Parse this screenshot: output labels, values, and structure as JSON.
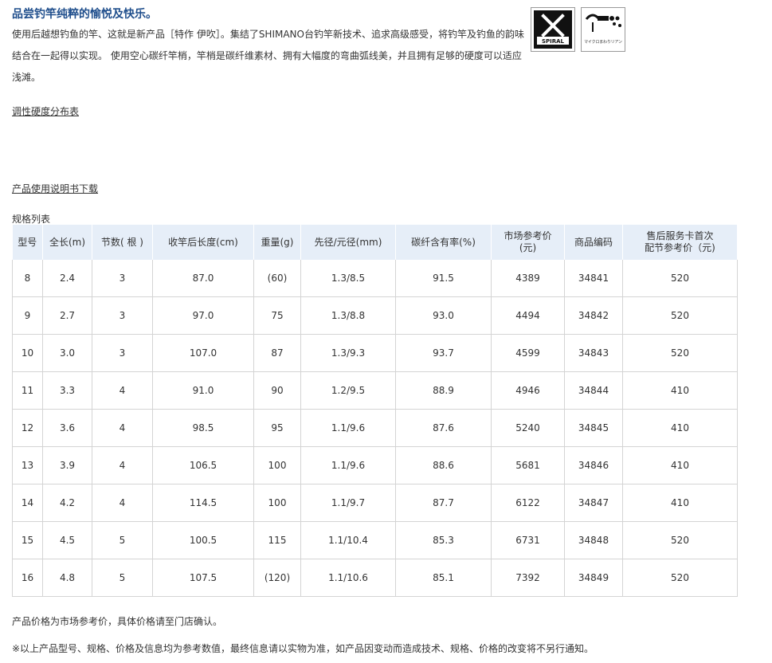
{
  "intro": {
    "title": "品尝钓竿纯粹的愉悦及快乐。",
    "description": "使用后越想钓鱼的竿、这就是新产品［特作 伊吹］。集结了SHIMANO台钓竿新技术、追求高级感受，将钓竿及钓鱼的韵味结合在一起得以实现。 使用空心碳纤竿梢，竿梢是碳纤维素材、拥有大幅度的弯曲弧线美，并且拥有足够的硬度可以适应浅滩。"
  },
  "badges": {
    "xspiral": {
      "icon": "x-spiral-logo",
      "letter": "X",
      "text": "SPIRAL"
    },
    "micro": {
      "icon": "micro-guide-logo",
      "text": "マイクロまわりリアン"
    }
  },
  "links": {
    "hardness": "调性硬度分布表",
    "manual": "产品使用说明书下载"
  },
  "spec": {
    "caption": "规格列表",
    "headers": [
      "型号",
      "全长(m)",
      "节数( 根 )",
      "收竿后长度(cm)",
      "重量(g)",
      "先径/元径(mm)",
      "碳纤含有率(%)",
      "市场参考价\n(元)",
      "商品编码",
      "售后服务卡首次\n配节参考价（元)"
    ],
    "rows": [
      [
        "8",
        "2.4",
        "3",
        "87.0",
        "(60)",
        "1.3/8.5",
        "91.5",
        "4389",
        "34841",
        "520"
      ],
      [
        "9",
        "2.7",
        "3",
        "97.0",
        "75",
        "1.3/8.8",
        "93.0",
        "4494",
        "34842",
        "520"
      ],
      [
        "10",
        "3.0",
        "3",
        "107.0",
        "87",
        "1.3/9.3",
        "93.7",
        "4599",
        "34843",
        "520"
      ],
      [
        "11",
        "3.3",
        "4",
        "91.0",
        "90",
        "1.2/9.5",
        "88.9",
        "4946",
        "34844",
        "410"
      ],
      [
        "12",
        "3.6",
        "4",
        "98.5",
        "95",
        "1.1/9.6",
        "87.6",
        "5240",
        "34845",
        "410"
      ],
      [
        "13",
        "3.9",
        "4",
        "106.5",
        "100",
        "1.1/9.6",
        "88.6",
        "5681",
        "34846",
        "410"
      ],
      [
        "14",
        "4.2",
        "4",
        "114.5",
        "100",
        "1.1/9.7",
        "87.7",
        "6122",
        "34847",
        "410"
      ],
      [
        "15",
        "4.5",
        "5",
        "100.5",
        "115",
        "1.1/10.4",
        "85.3",
        "6731",
        "34848",
        "520"
      ],
      [
        "16",
        "4.8",
        "5",
        "107.5",
        "(120)",
        "1.1/10.6",
        "85.1",
        "7392",
        "34849",
        "520"
      ]
    ]
  },
  "footer": {
    "note1": "产品价格为市场参考价，具体价格请至门店确认。",
    "note2": "※以上产品型号、规格、价格及信息均为参考数值，最终信息请以实物为准，如产品因变动而造成技术、规格、价格的改变将不另行通知。"
  }
}
